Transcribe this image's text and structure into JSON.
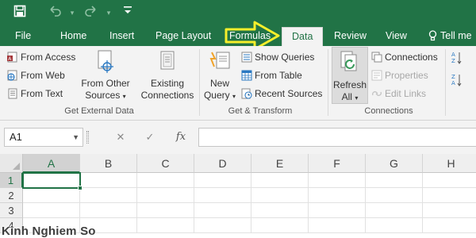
{
  "title_bar": {
    "save_icon": "save-icon",
    "undo_icon": "undo-icon",
    "redo_icon": "redo-icon",
    "customize_icon": "customize-toolbar-icon",
    "background": "#217346"
  },
  "tabs": [
    {
      "label": "File"
    },
    {
      "label": "Home"
    },
    {
      "label": "Insert"
    },
    {
      "label": "Page Layout"
    },
    {
      "label": "Formulas"
    },
    {
      "label": "Data",
      "active": true
    },
    {
      "label": "Review"
    },
    {
      "label": "View"
    }
  ],
  "tell_me": {
    "label": "Tell me"
  },
  "annotation_arrow_color": "#f6ef2b",
  "ribbon": {
    "get_external_data": {
      "from_access": "From Access",
      "from_web": "From Web",
      "from_text": "From Text",
      "from_other_line1": "From Other",
      "from_other_line2": "Sources",
      "existing_line1": "Existing",
      "existing_line2": "Connections",
      "group_label": "Get External Data"
    },
    "get_transform": {
      "new_query_line1": "New",
      "new_query_line2": "Query",
      "show_queries": "Show Queries",
      "from_table": "From Table",
      "recent_sources": "Recent Sources",
      "group_label": "Get & Transform"
    },
    "connections": {
      "refresh_line1": "Refresh",
      "refresh_line2": "All",
      "connections": "Connections",
      "properties": "Properties",
      "edit_links": "Edit Links",
      "group_label": "Connections"
    }
  },
  "formula_bar": {
    "name_box": "A1",
    "fx": "fx",
    "formula_value": ""
  },
  "grid": {
    "columns": [
      "A",
      "B",
      "C",
      "D",
      "E",
      "F",
      "G",
      "H"
    ],
    "rows": [
      "1",
      "2",
      "3",
      "4"
    ],
    "selected_cell": "A1"
  },
  "watermark": "Kinh Nghiem So"
}
